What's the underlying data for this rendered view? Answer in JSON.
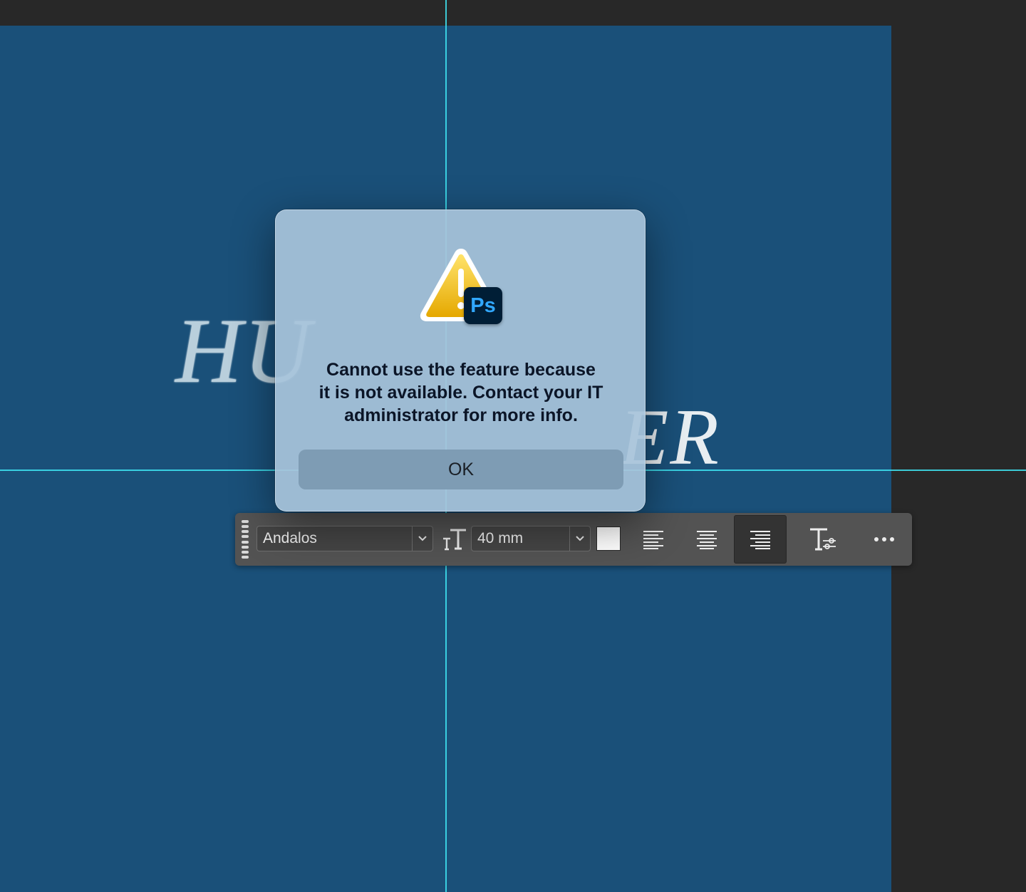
{
  "canvas": {
    "artwork_text_1": "HU",
    "artwork_text_2": "ER"
  },
  "dialog": {
    "app_badge": "Ps",
    "icon": "warning-icon",
    "message": "Cannot use the feature because\nit is not available. Contact your IT\nadministrator for more info.",
    "ok_label": "OK"
  },
  "toolbar": {
    "font_family": "Andalos",
    "font_size": "40 mm",
    "text_color": "#ffffff",
    "alignment_selected": "right",
    "icons": [
      "grip-icon",
      "chevron-down-icon",
      "text-size-icon",
      "align-left-icon",
      "align-center-icon",
      "align-right-icon",
      "text-settings-icon",
      "more-icon"
    ]
  },
  "colors": {
    "canvas": "#1a5079",
    "workspace": "#282828",
    "guide": "#3fe6f3",
    "dialog": "#a8c4da",
    "toolbar": "#535353"
  }
}
